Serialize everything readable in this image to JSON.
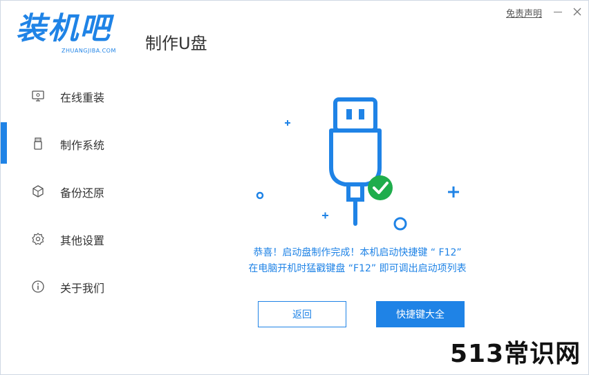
{
  "header": {
    "logo_text": "装机吧",
    "logo_subtext": "ZHUANGJIBA.COM",
    "title": "制作U盘",
    "disclaimer": "免责声明",
    "minimize_icon": "minimize-icon",
    "close_icon": "close-icon"
  },
  "sidebar": {
    "items": [
      {
        "label": "在线重装",
        "icon": "monitor-icon"
      },
      {
        "label": "制作系统",
        "icon": "usb-drive-icon",
        "active": true
      },
      {
        "label": "备份还原",
        "icon": "backup-cube-icon"
      },
      {
        "label": "其他设置",
        "icon": "gear-icon"
      },
      {
        "label": "关于我们",
        "icon": "info-icon"
      }
    ]
  },
  "main": {
    "message_line1": "恭喜！启动盘制作完成！本机启动快捷键 “ F12”",
    "message_line2": "在电脑开机时猛戳键盘 “F12” 即可调出启动项列表",
    "back_button": "返回",
    "hotkey_button": "快捷键大全"
  },
  "watermark": "513常识网",
  "colors": {
    "accent": "#1f83e6",
    "success": "#1fad4c",
    "text": "#333333"
  }
}
